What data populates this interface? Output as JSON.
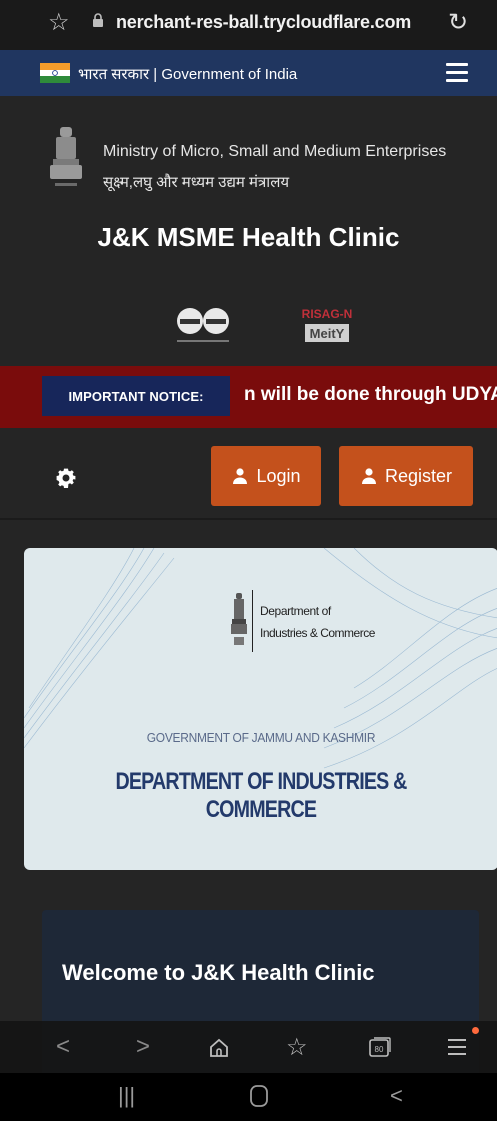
{
  "browser": {
    "url": "nerchant-res-ball.trycloudflare.com",
    "icons": [
      "bookmark-star-icon",
      "lock-icon",
      "reload-icon"
    ]
  },
  "gov_strip": {
    "text": "भारत सरकार | Government of India",
    "bg_color": "#203660"
  },
  "header": {
    "ministry_en": "Ministry of Micro, Small and Medium Enterprises",
    "ministry_hi": "सूक्ष्म,लघु और मध्यम उद्यम मंत्रालय",
    "title": "J&K MSME Health Clinic",
    "partner_logo_text": "RISAG-N MeitY"
  },
  "notice": {
    "badge": "IMPORTANT NOTICE:",
    "scrolling_text": "n will be done through UDYA",
    "bg_color": "#7a0c0c"
  },
  "actions": {
    "login_label": "Login",
    "register_label": "Register",
    "button_color": "#c4511c"
  },
  "banner": {
    "dept_line1": "Department of",
    "dept_line2": "Industries & Commerce",
    "gov_line": "GOVERNMENT OF JAMMU AND KASHMIR",
    "dept_title": "DEPARTMENT OF INDUSTRIES & COMMERCE"
  },
  "welcome": {
    "heading": "Welcome to J&K Health Clinic"
  },
  "browser_toolbar": {
    "icons": [
      "back-icon",
      "forward-icon",
      "home-icon",
      "bookmarks-icon",
      "tabs-icon",
      "menu-icon"
    ],
    "tabs_count": "80"
  },
  "android_nav": {
    "icons": [
      "recents-icon",
      "home-circle-icon",
      "back-chevron-icon"
    ]
  }
}
